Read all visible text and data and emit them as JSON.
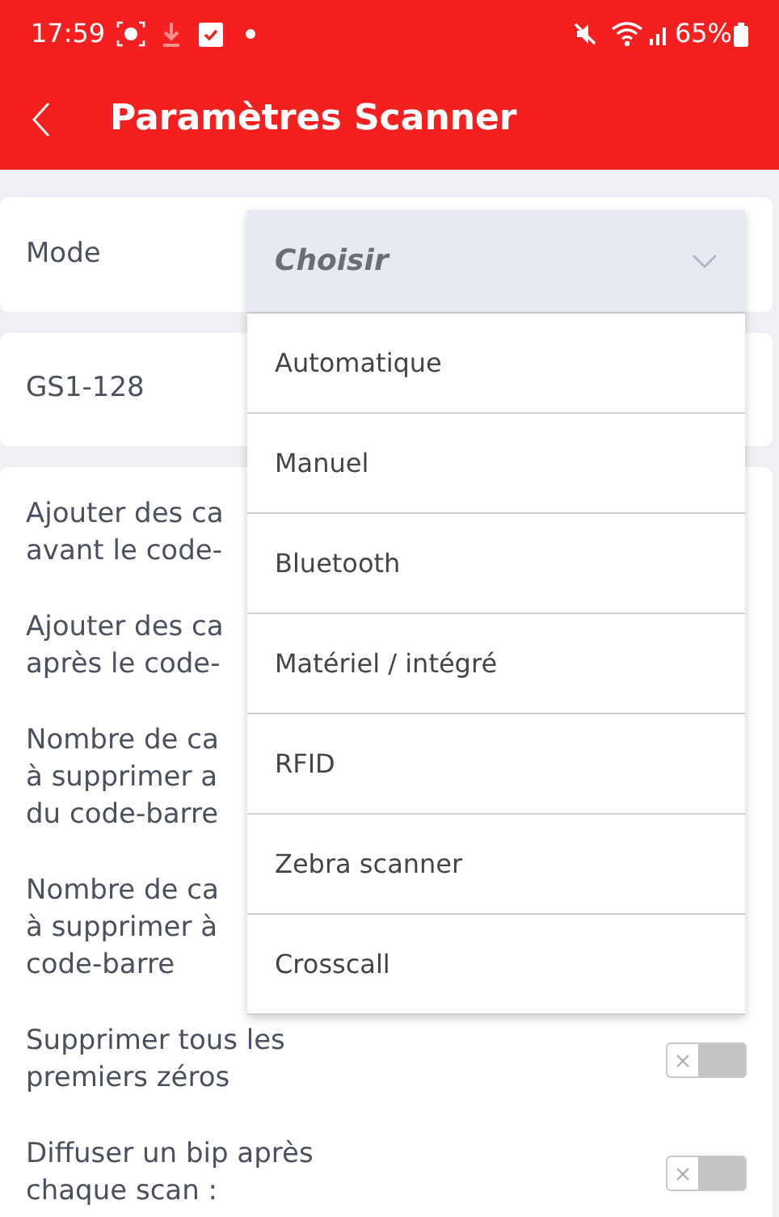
{
  "status_bar": {
    "time": "17:59",
    "battery": "65%"
  },
  "header": {
    "title": "Paramètres Scanner"
  },
  "mode": {
    "label": "Mode",
    "dropdown": {
      "placeholder": "Choisir",
      "expanded": true,
      "options": [
        "Automatique",
        "Manuel",
        "Bluetooth",
        "Matériel / intégré",
        "RFID",
        "Zebra scanner",
        "Crosscall"
      ]
    }
  },
  "gs1": {
    "label": "GS1-128"
  },
  "settings": [
    {
      "kind": "text",
      "lines": [
        "Ajouter des ca",
        "avant le code-"
      ]
    },
    {
      "kind": "text",
      "lines": [
        "Ajouter des ca",
        "après le code-"
      ]
    },
    {
      "kind": "text",
      "lines": [
        "Nombre de ca",
        "à supprimer a",
        "du code-barre"
      ]
    },
    {
      "kind": "text",
      "lines": [
        "Nombre de ca",
        "à supprimer à",
        "code-barre"
      ]
    },
    {
      "kind": "toggle",
      "on": false,
      "lines": [
        "Supprimer tous les",
        "premiers zéros"
      ]
    },
    {
      "kind": "toggle",
      "on": false,
      "lines": [
        "Diffuser un bip après",
        "chaque scan :"
      ]
    }
  ]
}
